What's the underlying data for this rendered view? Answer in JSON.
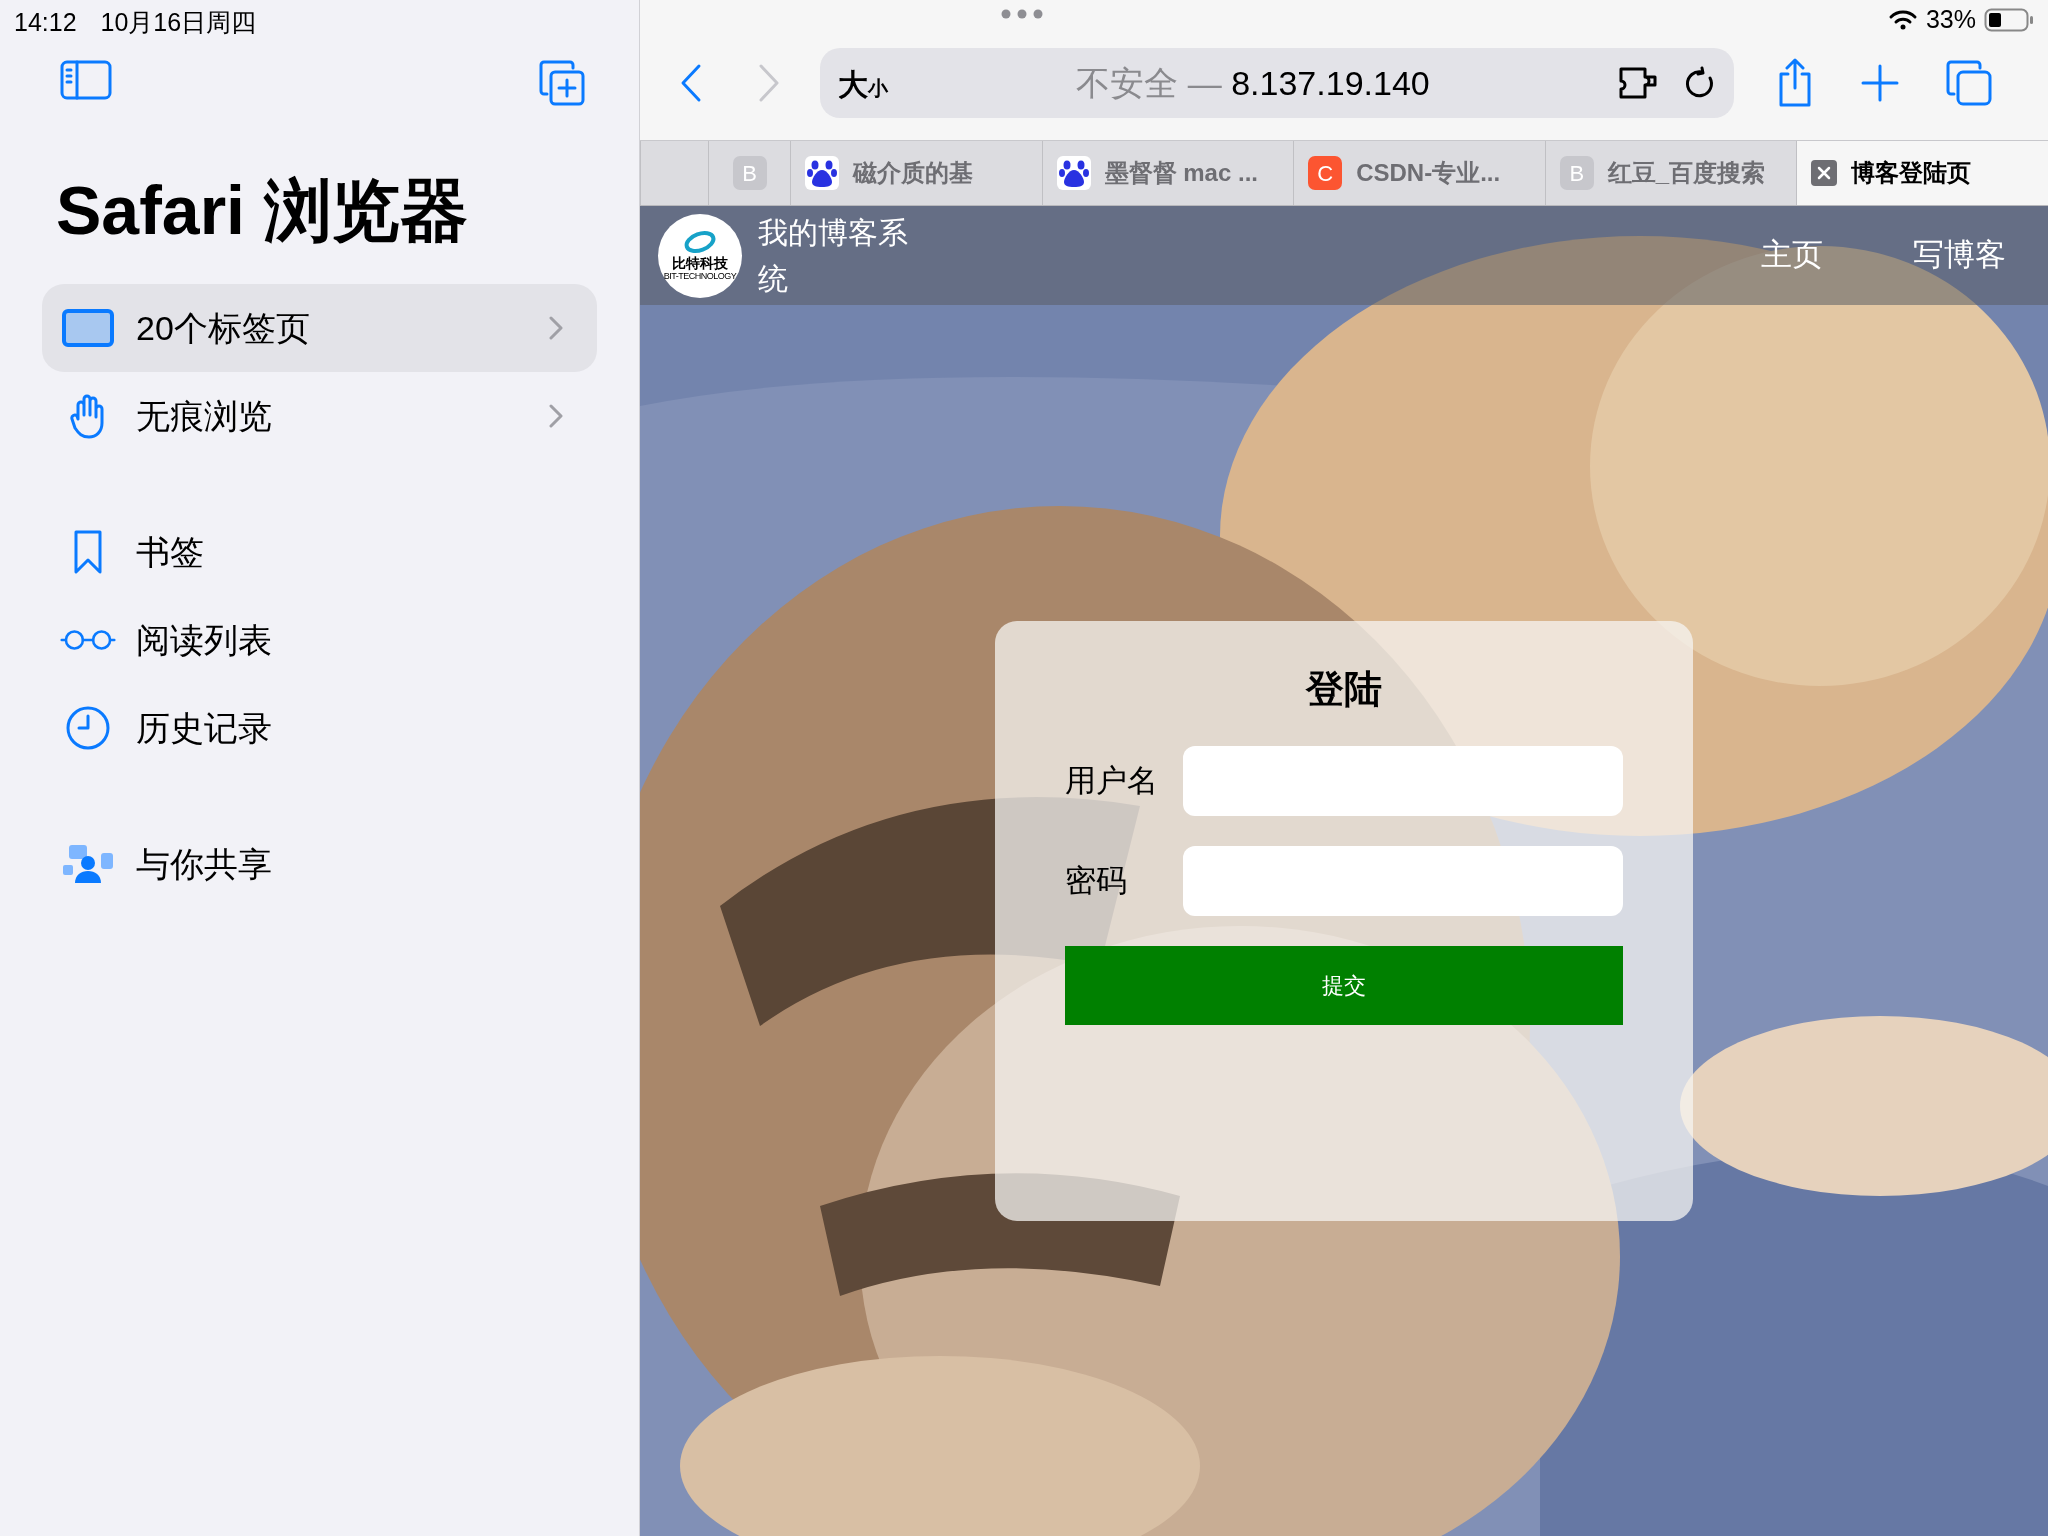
{
  "status_bar": {
    "time": "14:12",
    "date": "10月16日周四",
    "battery": "33%"
  },
  "sidebar": {
    "title": "Safari 浏览器",
    "sections": [
      {
        "items": [
          {
            "label": "20个标签页",
            "selected": true,
            "expandable": true
          },
          {
            "label": "无痕浏览",
            "selected": false,
            "expandable": true
          }
        ]
      },
      {
        "items": [
          {
            "label": "书签",
            "selected": false,
            "expandable": false
          },
          {
            "label": "阅读列表",
            "selected": false,
            "expandable": false
          },
          {
            "label": "历史记录",
            "selected": false,
            "expandable": false
          }
        ]
      },
      {
        "items": [
          {
            "label": "与你共享",
            "selected": false,
            "expandable": false
          }
        ]
      }
    ]
  },
  "toolbar": {
    "reader_large": "大",
    "reader_small": "小",
    "security": "不安全 —",
    "host": "8.137.19.140",
    "forward_enabled": false
  },
  "tabs": [
    {
      "kind": "letter",
      "icon_text": "B",
      "color": "#c7c7cc",
      "selected": false
    },
    {
      "kind": "paw",
      "title": "磁介质的基",
      "selected": false
    },
    {
      "kind": "paw",
      "title": "墨督督 mac ...",
      "selected": false
    },
    {
      "kind": "letter",
      "icon_text": "C",
      "color": "#fc5531",
      "title": "CSDN-专业...",
      "selected": false
    },
    {
      "kind": "letter",
      "icon_text": "B",
      "color": "#c7c7cc",
      "title": "红豆_百度搜索",
      "selected": false
    },
    {
      "kind": "close",
      "title": "博客登陆页",
      "selected": true
    }
  ],
  "site": {
    "logo_text": "比特科技",
    "logo_subtext": "BIT-TECHNOLOGY",
    "title": "我的博客系统",
    "nav": [
      "主页",
      "写博客"
    ]
  },
  "login": {
    "title": "登陆",
    "fields": [
      {
        "label": "用户名"
      },
      {
        "label": "密码"
      }
    ],
    "submit": "提交"
  }
}
